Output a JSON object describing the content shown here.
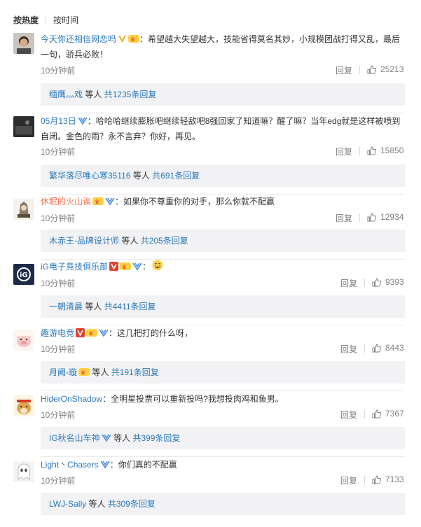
{
  "sort": {
    "hot": "按热度",
    "time": "按时间"
  },
  "reply_label": "回复",
  "others_label": "等人",
  "comments": [
    {
      "user": "今天你还相信网恋吗",
      "content": "：希望越大失望越大，技能省得莫名其妙，小规模团战打得又乱，最后一句，骄兵必败！",
      "time": "10分钟前",
      "likes": "25213",
      "replies": {
        "who": "缅鹰灬戏",
        "total": "共1235条回复"
      },
      "avatar": "person-photo"
    },
    {
      "user": "05月13日",
      "content": "：哈哈哈继续膨胀吧继续轻敌吧8强回家了知道嘛？醒了嘛？当年edg就是这样被喷到自闭。金色的雨？永不言弃？你好，再见。",
      "time": "10分钟前",
      "likes": "15850",
      "replies": {
        "who": "繁华落尽唯心寒35116",
        "total": "共691条回复"
      },
      "avatar": "dark-scene"
    },
    {
      "user": "休眠的火山诶",
      "content": "：如果你不尊重你的对手，那么你就不配赢",
      "time": "10分钟前",
      "likes": "12934",
      "replies": {
        "who": "木赤王-品牌设计师",
        "total": "共205条回复"
      },
      "avatar": "cartoon-knight"
    },
    {
      "user": "iG电子竞技俱乐部",
      "content": "：",
      "time": "10分钟前",
      "likes": "9393",
      "replies": {
        "who": "一朝清晨",
        "total": "共4411条回复"
      },
      "avatar": "ig-logo"
    },
    {
      "user": "趣游电竞",
      "content": "：这几把打的什么呀，",
      "time": "10分钟前",
      "likes": "8443",
      "replies": {
        "who": "月阙-璇",
        "total": "共191条回复"
      },
      "avatar": "cartoon-pig"
    },
    {
      "user": "HiderOnShadow",
      "content": "：全明星投票可以重新投吗?我想投肉鸡和鱼男。",
      "time": "10分钟前",
      "likes": "7367",
      "replies": {
        "who": "IG秋名山车神",
        "total": "共399条回复"
      },
      "avatar": "doge"
    },
    {
      "user": "Light丶Chasers",
      "content": "：你们真的不配赢",
      "time": "10分钟前",
      "likes": "7133",
      "replies": {
        "who": "LWJ-Sally",
        "total": "共309条回复"
      },
      "avatar": "ghost-face"
    }
  ],
  "colors": {
    "username": "#eb7350",
    "link": "#2a78b8",
    "muted": "#808080",
    "replybox_bg": "#f2f2f5"
  }
}
